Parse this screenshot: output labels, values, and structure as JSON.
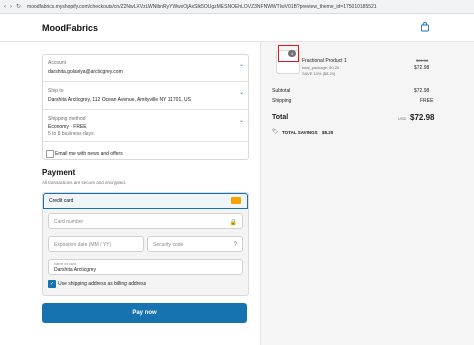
{
  "browser": {
    "url": "moodfabrics.myshopify.com/checkouts/cn/Z2NwLXVzLWNlbnRyYWwxOjAxSlk5OUgzMESNOEhLOVZ3NFNWWTIwV01B?preview_theme_id=175010185521"
  },
  "header": {
    "store_name": "MoodFabrics",
    "cart_icon": "shopping-bag-icon"
  },
  "review": {
    "account_label": "Account",
    "account_value": "darshita.golaviya@arcticgrey.com",
    "ship_to_label": "Ship to",
    "ship_to_value": "Darshita Arcticgrey, 112 Ocean Avenue, Amityville NY 11701, US",
    "shipping_method_label": "Shipping method",
    "shipping_method_value": "Economy · FREE",
    "shipping_method_eta": "5 to 8 business days"
  },
  "newsletter": {
    "label": "Email me with news and offers",
    "checked": false
  },
  "payment": {
    "title": "Payment",
    "subtitle": "All transactions are secure and encrypted.",
    "method_label": "Credit card",
    "card_number_placeholder": "Card number",
    "expiration_placeholder": "Expiration date (MM / YY)",
    "security_placeholder": "Security code",
    "name_label": "Name on card",
    "name_value": "Darshita Arcticgrey",
    "billing_same_label": "Use shipping address as billing address",
    "billing_same_checked": true,
    "pay_button": "Pay now"
  },
  "order_summary": {
    "product_name": "Fractional Product 1",
    "product_meta_1": "total_package: 50.25",
    "product_meta_2": "SAVE 10% ($8.20)",
    "quantity": "4",
    "original_price": "$81.18",
    "price": "$72.98",
    "subtotal_label": "Subtotal",
    "subtotal_value": "$72.98",
    "shipping_label": "Shipping",
    "shipping_value": "FREE",
    "total_label": "Total",
    "currency": "USD",
    "total_value": "$72.98",
    "savings_label": "TOTAL SAVINGS",
    "savings_value": "$8.20"
  },
  "colors": {
    "accent": "#1773b0",
    "highlight_box": "#e0181b"
  }
}
